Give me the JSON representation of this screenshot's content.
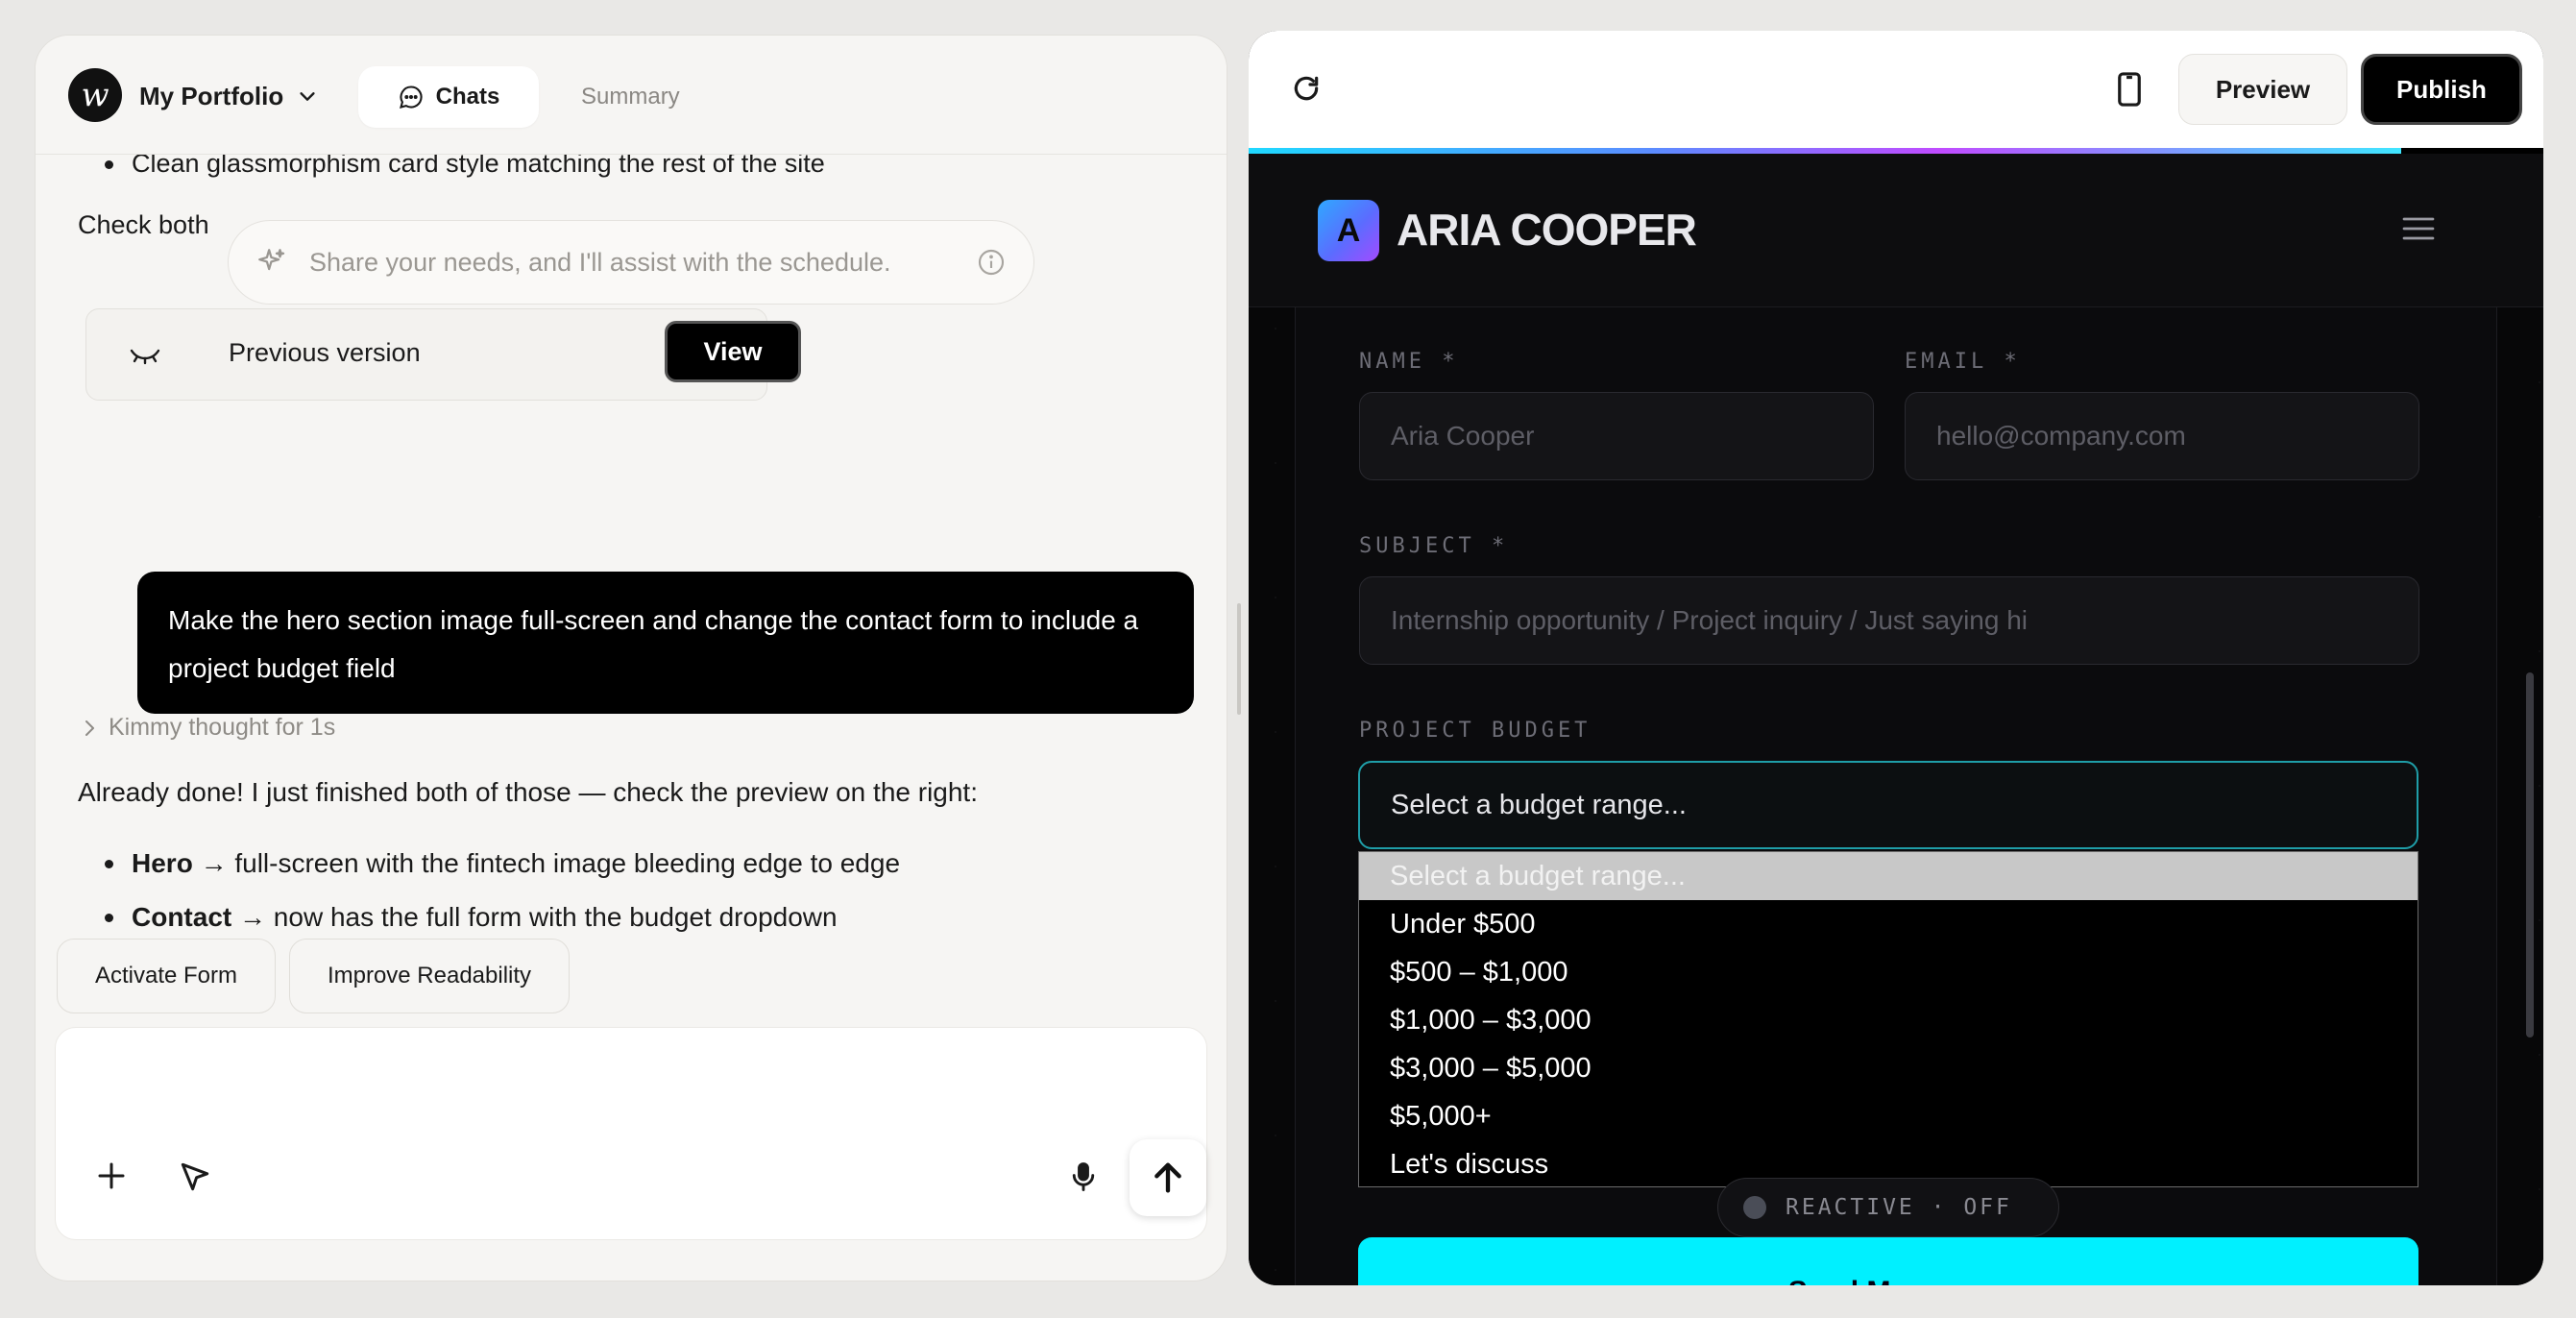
{
  "left": {
    "project_name": "My Portfolio",
    "tabs": {
      "chats": "Chats",
      "summary": "Summary"
    },
    "partial_bullet": "Clean glassmorphism card style matching the rest of the site",
    "check_both": "Check both",
    "assist_placeholder": "Share your needs, and I'll assist with the schedule.",
    "previous_version": {
      "label": "Previous version",
      "button": "View"
    },
    "user_message": "Make the hero section image full-screen and change the contact form to include a project budget field",
    "thought": "Kimmy thought for 1s",
    "reply_intro": "Already done! I just finished both of those — check the preview on the right:",
    "reply_bullets": [
      {
        "bold": "Hero",
        "text": " → full-screen with the fintech image bleeding edge to edge"
      },
      {
        "bold": "Contact",
        "text": " → now has the full form with the budget dropdown"
      }
    ],
    "chips": [
      "Activate Form",
      "Improve Readability"
    ],
    "composer_placeholder": ""
  },
  "right": {
    "toolbar": {
      "preview": "Preview",
      "publish": "Publish"
    },
    "site": {
      "logo_letter": "A",
      "name": "ARIA COOPER",
      "form": {
        "name_label": "NAME *",
        "name_placeholder": "Aria Cooper",
        "email_label": "EMAIL *",
        "email_placeholder": "hello@company.com",
        "subject_label": "SUBJECT *",
        "subject_placeholder": "Internship opportunity / Project inquiry / Just saying hi",
        "budget_label": "PROJECT BUDGET",
        "budget_value": "Select a budget range...",
        "budget_options": [
          "Select a budget range...",
          "Under $500",
          "$500 – $1,000",
          "$1,000 – $3,000",
          "$3,000 – $5,000",
          "$5,000+",
          "Let's discuss"
        ],
        "reactive": "REACTIVE · OFF",
        "send_label": "Send Message"
      }
    }
  },
  "colors": {
    "accent_cyan": "#00f0ff",
    "select_border": "#1f9ea8",
    "logo_gradient_start": "#2fa8ff",
    "logo_gradient_end": "#a24bff"
  }
}
